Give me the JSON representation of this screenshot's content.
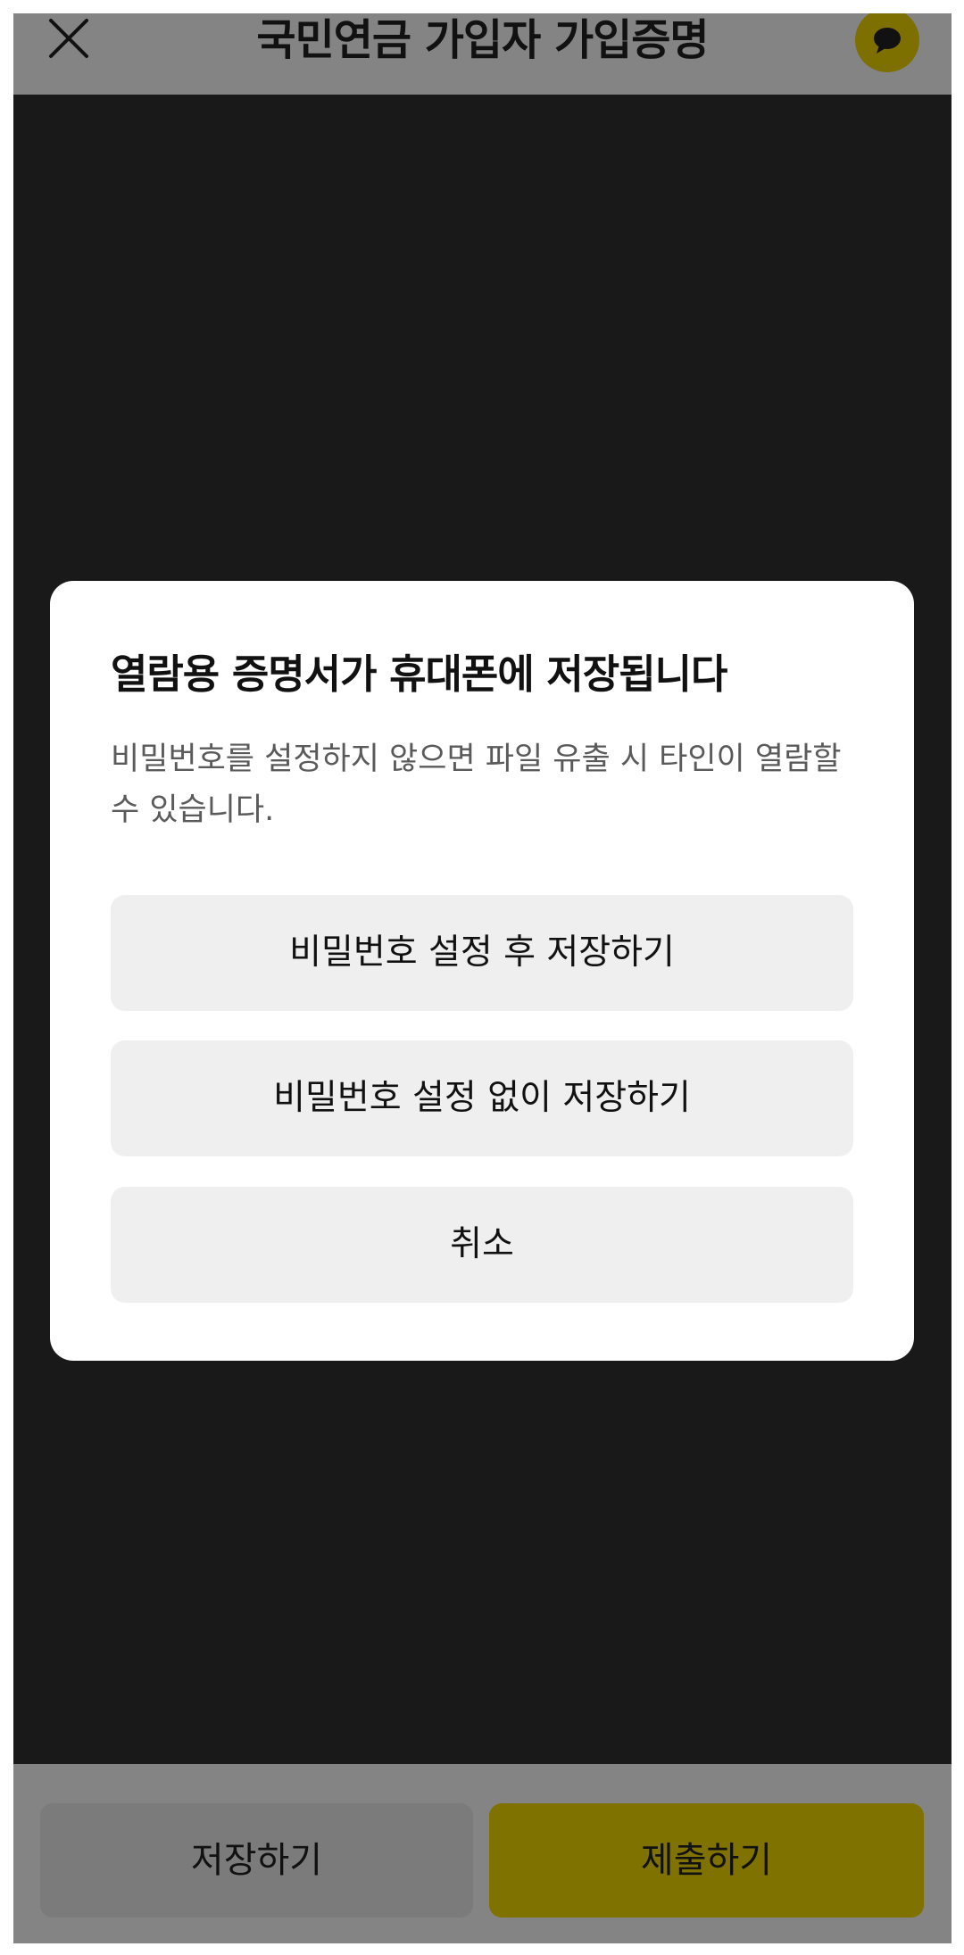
{
  "header": {
    "title": "국민연금 가입자 가입증명",
    "close_icon": "close-icon",
    "chat_icon": "chat-bubble-icon"
  },
  "dialog": {
    "title": "열람용 증명서가 휴대폰에 저장됩니다",
    "description": "비밀번호를 설정하지 않으면 파일 유출 시 타인이 열람할 수 있습니다.",
    "save_with_password_label": "비밀번호 설정 후 저장하기",
    "save_without_password_label": "비밀번호 설정 없이 저장하기",
    "cancel_label": "취소"
  },
  "bottom_bar": {
    "save_label": "저장하기",
    "submit_label": "제출하기"
  },
  "colors": {
    "accent": "#7f7200",
    "overlay_dark": "#191919",
    "overlay_gray": "#848484",
    "dialog_button": "#efefef"
  }
}
